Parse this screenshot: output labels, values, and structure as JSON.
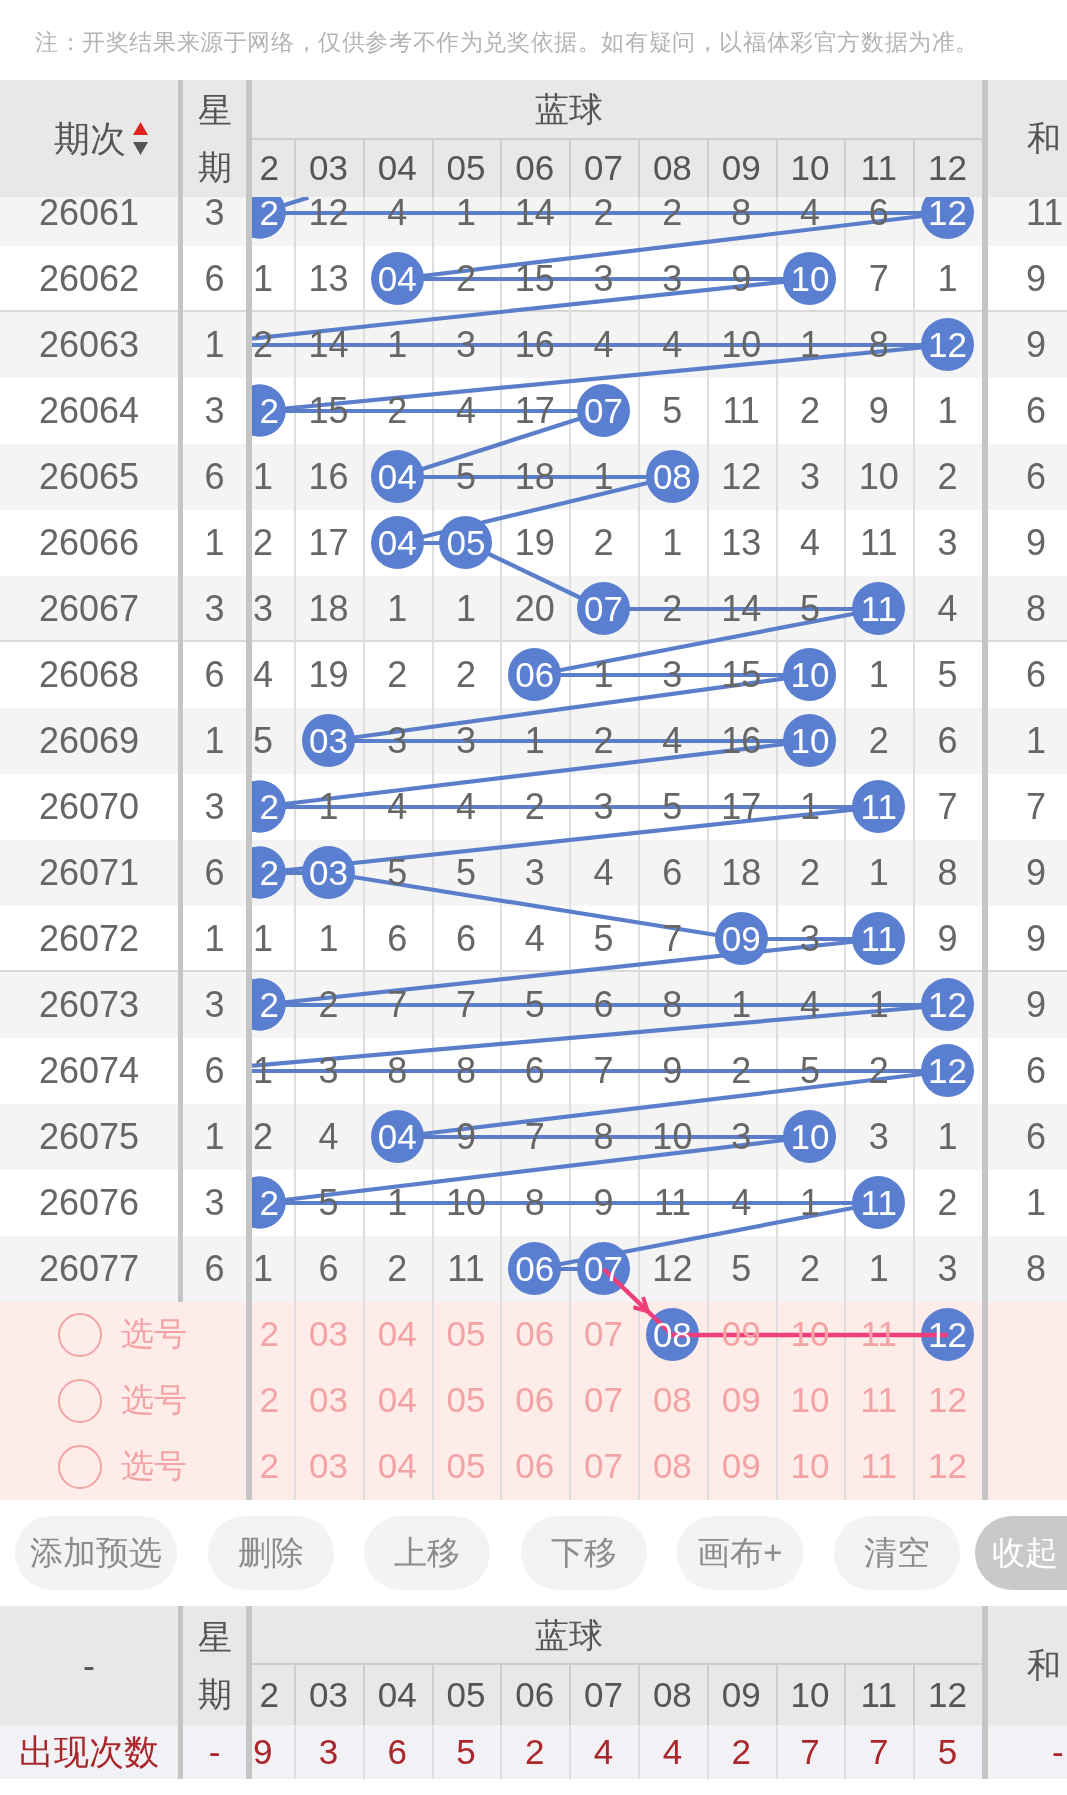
{
  "notice": "注：开奖结果来源于网络，仅供参考不作为兑奖依据。如有疑问，以福体彩官方数据为准。",
  "header": {
    "issue": "期次",
    "sort_ascending": true,
    "weekday": "星期",
    "group": "蓝球",
    "columns": [
      "2",
      "03",
      "04",
      "05",
      "06",
      "07",
      "08",
      "09",
      "10",
      "11",
      "12"
    ],
    "sum": "和"
  },
  "trend_line": {
    "enters_from_above": true
  },
  "rows": [
    {
      "issue": "26061",
      "weekday": "3",
      "hidden_ball_left": false,
      "cells": [
        {
          "kind": "ball",
          "text": "2"
        },
        {
          "kind": "miss",
          "text": "12"
        },
        {
          "kind": "miss",
          "text": "4"
        },
        {
          "kind": "miss",
          "text": "1"
        },
        {
          "kind": "miss",
          "text": "14"
        },
        {
          "kind": "miss",
          "text": "2"
        },
        {
          "kind": "miss",
          "text": "2"
        },
        {
          "kind": "miss",
          "text": "8"
        },
        {
          "kind": "miss",
          "text": "4"
        },
        {
          "kind": "miss",
          "text": "6"
        },
        {
          "kind": "ball",
          "text": "12"
        }
      ],
      "sum": "11"
    },
    {
      "issue": "26062",
      "weekday": "6",
      "hidden_ball_left": false,
      "cells": [
        {
          "kind": "miss",
          "text": "1"
        },
        {
          "kind": "miss",
          "text": "13"
        },
        {
          "kind": "ball",
          "text": "04"
        },
        {
          "kind": "miss",
          "text": "2"
        },
        {
          "kind": "miss",
          "text": "15"
        },
        {
          "kind": "miss",
          "text": "3"
        },
        {
          "kind": "miss",
          "text": "3"
        },
        {
          "kind": "miss",
          "text": "9"
        },
        {
          "kind": "ball",
          "text": "10"
        },
        {
          "kind": "miss",
          "text": "7"
        },
        {
          "kind": "miss",
          "text": "1"
        }
      ],
      "sum": "9"
    },
    {
      "issue": "26063",
      "weekday": "1",
      "hidden_ball_left": true,
      "cells": [
        {
          "kind": "miss",
          "text": "2"
        },
        {
          "kind": "miss",
          "text": "14"
        },
        {
          "kind": "miss",
          "text": "1"
        },
        {
          "kind": "miss",
          "text": "3"
        },
        {
          "kind": "miss",
          "text": "16"
        },
        {
          "kind": "miss",
          "text": "4"
        },
        {
          "kind": "miss",
          "text": "4"
        },
        {
          "kind": "miss",
          "text": "10"
        },
        {
          "kind": "miss",
          "text": "1"
        },
        {
          "kind": "miss",
          "text": "8"
        },
        {
          "kind": "ball",
          "text": "12"
        }
      ],
      "sum": "9"
    },
    {
      "issue": "26064",
      "weekday": "3",
      "hidden_ball_left": false,
      "cells": [
        {
          "kind": "ball",
          "text": "2"
        },
        {
          "kind": "miss",
          "text": "15"
        },
        {
          "kind": "miss",
          "text": "2"
        },
        {
          "kind": "miss",
          "text": "4"
        },
        {
          "kind": "miss",
          "text": "17"
        },
        {
          "kind": "ball",
          "text": "07"
        },
        {
          "kind": "miss",
          "text": "5"
        },
        {
          "kind": "miss",
          "text": "11"
        },
        {
          "kind": "miss",
          "text": "2"
        },
        {
          "kind": "miss",
          "text": "9"
        },
        {
          "kind": "miss",
          "text": "1"
        }
      ],
      "sum": "6"
    },
    {
      "issue": "26065",
      "weekday": "6",
      "hidden_ball_left": false,
      "cells": [
        {
          "kind": "miss",
          "text": "1"
        },
        {
          "kind": "miss",
          "text": "16"
        },
        {
          "kind": "ball",
          "text": "04"
        },
        {
          "kind": "miss",
          "text": "5"
        },
        {
          "kind": "miss",
          "text": "18"
        },
        {
          "kind": "miss",
          "text": "1"
        },
        {
          "kind": "ball",
          "text": "08"
        },
        {
          "kind": "miss",
          "text": "12"
        },
        {
          "kind": "miss",
          "text": "3"
        },
        {
          "kind": "miss",
          "text": "10"
        },
        {
          "kind": "miss",
          "text": "2"
        }
      ],
      "sum": "6"
    },
    {
      "issue": "26066",
      "weekday": "1",
      "hidden_ball_left": false,
      "cells": [
        {
          "kind": "miss",
          "text": "2"
        },
        {
          "kind": "miss",
          "text": "17"
        },
        {
          "kind": "ball",
          "text": "04"
        },
        {
          "kind": "ball",
          "text": "05"
        },
        {
          "kind": "miss",
          "text": "19"
        },
        {
          "kind": "miss",
          "text": "2"
        },
        {
          "kind": "miss",
          "text": "1"
        },
        {
          "kind": "miss",
          "text": "13"
        },
        {
          "kind": "miss",
          "text": "4"
        },
        {
          "kind": "miss",
          "text": "11"
        },
        {
          "kind": "miss",
          "text": "3"
        }
      ],
      "sum": "9"
    },
    {
      "issue": "26067",
      "weekday": "3",
      "hidden_ball_left": false,
      "cells": [
        {
          "kind": "miss",
          "text": "3"
        },
        {
          "kind": "miss",
          "text": "18"
        },
        {
          "kind": "miss",
          "text": "1"
        },
        {
          "kind": "miss",
          "text": "1"
        },
        {
          "kind": "miss",
          "text": "20"
        },
        {
          "kind": "ball",
          "text": "07"
        },
        {
          "kind": "miss",
          "text": "2"
        },
        {
          "kind": "miss",
          "text": "14"
        },
        {
          "kind": "miss",
          "text": "5"
        },
        {
          "kind": "ball",
          "text": "11"
        },
        {
          "kind": "miss",
          "text": "4"
        }
      ],
      "sum": "8"
    },
    {
      "issue": "26068",
      "weekday": "6",
      "hidden_ball_left": false,
      "cells": [
        {
          "kind": "miss",
          "text": "4"
        },
        {
          "kind": "miss",
          "text": "19"
        },
        {
          "kind": "miss",
          "text": "2"
        },
        {
          "kind": "miss",
          "text": "2"
        },
        {
          "kind": "ball",
          "text": "06"
        },
        {
          "kind": "miss",
          "text": "1"
        },
        {
          "kind": "miss",
          "text": "3"
        },
        {
          "kind": "miss",
          "text": "15"
        },
        {
          "kind": "ball",
          "text": "10"
        },
        {
          "kind": "miss",
          "text": "1"
        },
        {
          "kind": "miss",
          "text": "5"
        }
      ],
      "sum": "6"
    },
    {
      "issue": "26069",
      "weekday": "1",
      "hidden_ball_left": false,
      "cells": [
        {
          "kind": "miss",
          "text": "5"
        },
        {
          "kind": "ball",
          "text": "03"
        },
        {
          "kind": "miss",
          "text": "3"
        },
        {
          "kind": "miss",
          "text": "3"
        },
        {
          "kind": "miss",
          "text": "1"
        },
        {
          "kind": "miss",
          "text": "2"
        },
        {
          "kind": "miss",
          "text": "4"
        },
        {
          "kind": "miss",
          "text": "16"
        },
        {
          "kind": "ball",
          "text": "10"
        },
        {
          "kind": "miss",
          "text": "2"
        },
        {
          "kind": "miss",
          "text": "6"
        }
      ],
      "sum": "1"
    },
    {
      "issue": "26070",
      "weekday": "3",
      "hidden_ball_left": false,
      "cells": [
        {
          "kind": "ball",
          "text": "2"
        },
        {
          "kind": "miss",
          "text": "1"
        },
        {
          "kind": "miss",
          "text": "4"
        },
        {
          "kind": "miss",
          "text": "4"
        },
        {
          "kind": "miss",
          "text": "2"
        },
        {
          "kind": "miss",
          "text": "3"
        },
        {
          "kind": "miss",
          "text": "5"
        },
        {
          "kind": "miss",
          "text": "17"
        },
        {
          "kind": "miss",
          "text": "1"
        },
        {
          "kind": "ball",
          "text": "11"
        },
        {
          "kind": "miss",
          "text": "7"
        }
      ],
      "sum": "7"
    },
    {
      "issue": "26071",
      "weekday": "6",
      "hidden_ball_left": false,
      "cells": [
        {
          "kind": "ball",
          "text": "2"
        },
        {
          "kind": "ball",
          "text": "03"
        },
        {
          "kind": "miss",
          "text": "5"
        },
        {
          "kind": "miss",
          "text": "5"
        },
        {
          "kind": "miss",
          "text": "3"
        },
        {
          "kind": "miss",
          "text": "4"
        },
        {
          "kind": "miss",
          "text": "6"
        },
        {
          "kind": "miss",
          "text": "18"
        },
        {
          "kind": "miss",
          "text": "2"
        },
        {
          "kind": "miss",
          "text": "1"
        },
        {
          "kind": "miss",
          "text": "8"
        }
      ],
      "sum": "9"
    },
    {
      "issue": "26072",
      "weekday": "1",
      "hidden_ball_left": false,
      "cells": [
        {
          "kind": "miss",
          "text": "1"
        },
        {
          "kind": "miss",
          "text": "1"
        },
        {
          "kind": "miss",
          "text": "6"
        },
        {
          "kind": "miss",
          "text": "6"
        },
        {
          "kind": "miss",
          "text": "4"
        },
        {
          "kind": "miss",
          "text": "5"
        },
        {
          "kind": "miss",
          "text": "7"
        },
        {
          "kind": "ball",
          "text": "09"
        },
        {
          "kind": "miss",
          "text": "3"
        },
        {
          "kind": "ball",
          "text": "11"
        },
        {
          "kind": "miss",
          "text": "9"
        }
      ],
      "sum": "9"
    },
    {
      "issue": "26073",
      "weekday": "3",
      "hidden_ball_left": false,
      "cells": [
        {
          "kind": "ball",
          "text": "2"
        },
        {
          "kind": "miss",
          "text": "2"
        },
        {
          "kind": "miss",
          "text": "7"
        },
        {
          "kind": "miss",
          "text": "7"
        },
        {
          "kind": "miss",
          "text": "5"
        },
        {
          "kind": "miss",
          "text": "6"
        },
        {
          "kind": "miss",
          "text": "8"
        },
        {
          "kind": "miss",
          "text": "1"
        },
        {
          "kind": "miss",
          "text": "4"
        },
        {
          "kind": "miss",
          "text": "1"
        },
        {
          "kind": "ball",
          "text": "12"
        }
      ],
      "sum": "9"
    },
    {
      "issue": "26074",
      "weekday": "6",
      "hidden_ball_left": true,
      "cells": [
        {
          "kind": "miss",
          "text": "1"
        },
        {
          "kind": "miss",
          "text": "3"
        },
        {
          "kind": "miss",
          "text": "8"
        },
        {
          "kind": "miss",
          "text": "8"
        },
        {
          "kind": "miss",
          "text": "6"
        },
        {
          "kind": "miss",
          "text": "7"
        },
        {
          "kind": "miss",
          "text": "9"
        },
        {
          "kind": "miss",
          "text": "2"
        },
        {
          "kind": "miss",
          "text": "5"
        },
        {
          "kind": "miss",
          "text": "2"
        },
        {
          "kind": "ball",
          "text": "12"
        }
      ],
      "sum": "6"
    },
    {
      "issue": "26075",
      "weekday": "1",
      "hidden_ball_left": false,
      "cells": [
        {
          "kind": "miss",
          "text": "2"
        },
        {
          "kind": "miss",
          "text": "4"
        },
        {
          "kind": "ball",
          "text": "04"
        },
        {
          "kind": "miss",
          "text": "9"
        },
        {
          "kind": "miss",
          "text": "7"
        },
        {
          "kind": "miss",
          "text": "8"
        },
        {
          "kind": "miss",
          "text": "10"
        },
        {
          "kind": "miss",
          "text": "3"
        },
        {
          "kind": "ball",
          "text": "10"
        },
        {
          "kind": "miss",
          "text": "3"
        },
        {
          "kind": "miss",
          "text": "1"
        }
      ],
      "sum": "6"
    },
    {
      "issue": "26076",
      "weekday": "3",
      "hidden_ball_left": false,
      "cells": [
        {
          "kind": "ball",
          "text": "2"
        },
        {
          "kind": "miss",
          "text": "5"
        },
        {
          "kind": "miss",
          "text": "1"
        },
        {
          "kind": "miss",
          "text": "10"
        },
        {
          "kind": "miss",
          "text": "8"
        },
        {
          "kind": "miss",
          "text": "9"
        },
        {
          "kind": "miss",
          "text": "11"
        },
        {
          "kind": "miss",
          "text": "4"
        },
        {
          "kind": "miss",
          "text": "1"
        },
        {
          "kind": "ball",
          "text": "11"
        },
        {
          "kind": "miss",
          "text": "2"
        }
      ],
      "sum": "1"
    },
    {
      "issue": "26077",
      "weekday": "6",
      "hidden_ball_left": false,
      "cells": [
        {
          "kind": "miss",
          "text": "1"
        },
        {
          "kind": "miss",
          "text": "6"
        },
        {
          "kind": "miss",
          "text": "2"
        },
        {
          "kind": "miss",
          "text": "11"
        },
        {
          "kind": "ball",
          "text": "06"
        },
        {
          "kind": "ball",
          "text": "07"
        },
        {
          "kind": "miss",
          "text": "12"
        },
        {
          "kind": "miss",
          "text": "5"
        },
        {
          "kind": "miss",
          "text": "2"
        },
        {
          "kind": "miss",
          "text": "1"
        },
        {
          "kind": "miss",
          "text": "3"
        }
      ],
      "sum": "8"
    }
  ],
  "selection_rows": [
    {
      "checked": false,
      "label": "选号",
      "numbers": [
        {
          "text": "2",
          "selected": false
        },
        {
          "text": "03",
          "selected": false
        },
        {
          "text": "04",
          "selected": false
        },
        {
          "text": "05",
          "selected": false
        },
        {
          "text": "06",
          "selected": false
        },
        {
          "text": "07",
          "selected": false
        },
        {
          "text": "08",
          "selected": true
        },
        {
          "text": "09",
          "selected": false
        },
        {
          "text": "10",
          "selected": false
        },
        {
          "text": "11",
          "selected": false
        },
        {
          "text": "12",
          "selected": true
        }
      ]
    },
    {
      "checked": false,
      "label": "选号",
      "numbers": [
        {
          "text": "2",
          "selected": false
        },
        {
          "text": "03",
          "selected": false
        },
        {
          "text": "04",
          "selected": false
        },
        {
          "text": "05",
          "selected": false
        },
        {
          "text": "06",
          "selected": false
        },
        {
          "text": "07",
          "selected": false
        },
        {
          "text": "08",
          "selected": false
        },
        {
          "text": "09",
          "selected": false
        },
        {
          "text": "10",
          "selected": false
        },
        {
          "text": "11",
          "selected": false
        },
        {
          "text": "12",
          "selected": false
        }
      ]
    },
    {
      "checked": false,
      "label": "选号",
      "numbers": [
        {
          "text": "2",
          "selected": false
        },
        {
          "text": "03",
          "selected": false
        },
        {
          "text": "04",
          "selected": false
        },
        {
          "text": "05",
          "selected": false
        },
        {
          "text": "06",
          "selected": false
        },
        {
          "text": "07",
          "selected": false
        },
        {
          "text": "08",
          "selected": false
        },
        {
          "text": "09",
          "selected": false
        },
        {
          "text": "10",
          "selected": false
        },
        {
          "text": "11",
          "selected": false
        },
        {
          "text": "12",
          "selected": false
        }
      ]
    }
  ],
  "buttons": [
    {
      "label": "添加预选",
      "active": false
    },
    {
      "label": "删除",
      "active": false
    },
    {
      "label": "上移",
      "active": false
    },
    {
      "label": "下移",
      "active": false
    },
    {
      "label": "画布+",
      "active": false
    },
    {
      "label": "清空",
      "active": false
    },
    {
      "label": "收起",
      "active": true
    }
  ],
  "footer_header": {
    "issue": "-",
    "weekday": "星期",
    "group": "蓝球",
    "columns": [
      "2",
      "03",
      "04",
      "05",
      "06",
      "07",
      "08",
      "09",
      "10",
      "11",
      "12"
    ],
    "sum": "和"
  },
  "count_row": {
    "label": "出现次数",
    "weekday": "-",
    "counts": [
      "9",
      "3",
      "6",
      "5",
      "2",
      "4",
      "4",
      "2",
      "7",
      "7",
      "5"
    ],
    "sum": "-"
  }
}
